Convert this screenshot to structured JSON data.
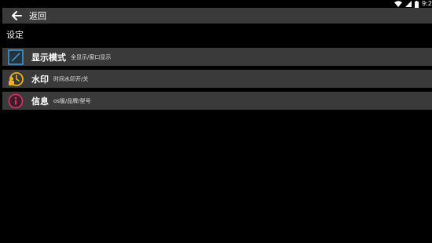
{
  "status_bar": {
    "time": "9:2",
    "icons": [
      "wifi-icon",
      "signal-icon",
      "battery-icon"
    ]
  },
  "app_bar": {
    "back_icon": "arrow-left-icon",
    "back_label": "返回"
  },
  "section": {
    "title": "设定"
  },
  "items": [
    {
      "title": "显示模式",
      "subtitle": "全显示/窗口显示",
      "icon": "display-mode-icon",
      "icon_color": "#3aa0d8"
    },
    {
      "title": "水印",
      "subtitle": "时间水印开/关",
      "icon": "watermark-icon",
      "icon_color": "#f0b020"
    },
    {
      "title": "信息",
      "subtitle": "os版/品牌/型号",
      "icon": "info-icon",
      "icon_color": "#e0306a"
    }
  ],
  "colors": {
    "background": "#000000",
    "bar": "#3a3a3a",
    "text": "#ffffff"
  }
}
